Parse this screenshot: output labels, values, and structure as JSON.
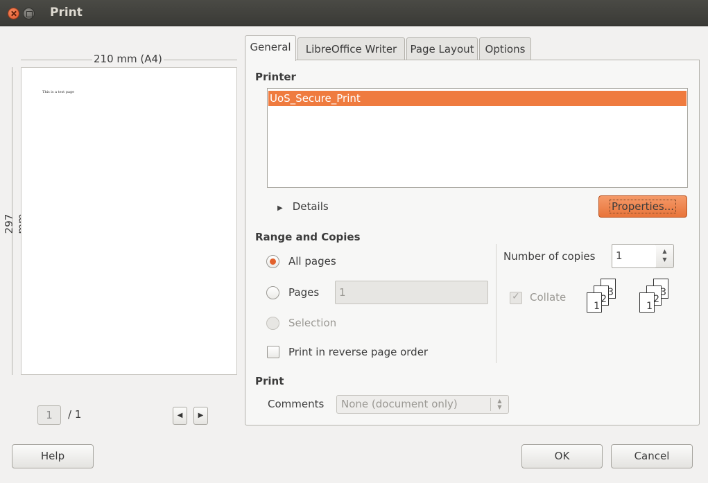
{
  "window": {
    "title": "Print"
  },
  "preview": {
    "width_label": "210 mm (A4)",
    "height_label": "297 mm",
    "page_text": "This is a test page",
    "current_page": "1",
    "total_pages": "/ 1",
    "prev_glyph": "◀",
    "next_glyph": "▶"
  },
  "tabs": [
    {
      "label": "General",
      "active": true
    },
    {
      "label": "LibreOffice Writer",
      "active": false
    },
    {
      "label": "Page Layout",
      "active": false
    },
    {
      "label": "Options",
      "active": false
    }
  ],
  "printer": {
    "section_title": "Printer",
    "items": [
      "UoS_Secure_Print"
    ],
    "details_label": "Details",
    "properties_label": "Properties..."
  },
  "range": {
    "section_title": "Range and Copies",
    "all_pages_label": "All pages",
    "pages_label": "Pages",
    "pages_value": "1",
    "selection_label": "Selection",
    "reverse_label": "Print in reverse page order",
    "copies_label": "Number of copies",
    "copies_value": "1",
    "collate_label": "Collate"
  },
  "print": {
    "section_title": "Print",
    "comments_label": "Comments",
    "comments_value": "None (document only)"
  },
  "buttons": {
    "help": "Help",
    "ok": "OK",
    "cancel": "Cancel"
  },
  "colors": {
    "accent": "#ef7b3f",
    "titlebar": "#3c3b37",
    "background": "#f2f1f0"
  }
}
